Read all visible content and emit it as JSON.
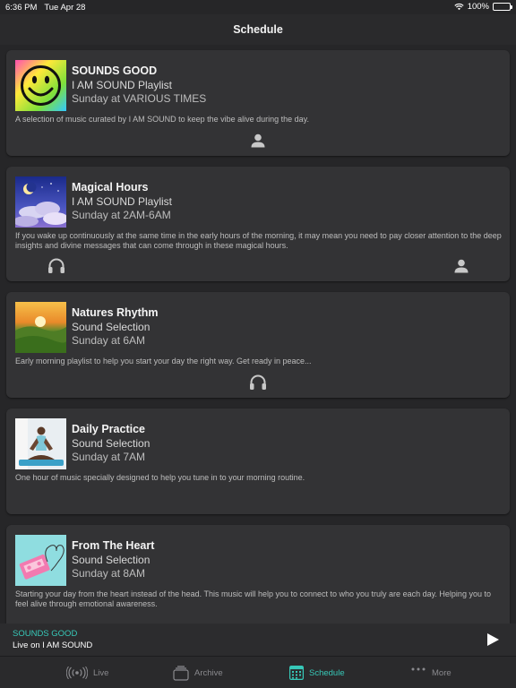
{
  "status_bar": {
    "time": "6:36 PM",
    "date": "Tue Apr 28",
    "battery": "100%"
  },
  "header": {
    "title": "Schedule"
  },
  "schedule": [
    {
      "title": "SOUNDS GOOD",
      "subtitle": "I AM SOUND Playlist",
      "time": "Sunday at VARIOUS TIMES",
      "description": "A selection of music curated by I AM SOUND to keep the vibe alive during the day.",
      "icon": "smiley-image"
    },
    {
      "title": "Magical Hours",
      "subtitle": "I AM SOUND Playlist",
      "time": "Sunday at 2AM-6AM",
      "description": "If you wake up continuously at the same time in the early hours of the morning, it may mean you need to pay closer attention to the deep insights and divine messages that can come through in these magical hours.",
      "icon": "moon-clouds-image"
    },
    {
      "title": "Natures Rhythm",
      "subtitle": "Sound Selection",
      "time": "Sunday at 6AM",
      "description": "Early morning playlist to help you start your day the right way. Get ready in peace...",
      "icon": "sunrise-landscape-image"
    },
    {
      "title": "Daily Practice",
      "subtitle": "Sound Selection",
      "time": "Sunday at 7AM",
      "description": "One hour of music specially designed to help you tune in to your morning routine.",
      "icon": "meditation-image"
    },
    {
      "title": "From The Heart",
      "subtitle": "Sound Selection",
      "time": "Sunday at 8AM",
      "description": "Starting your day from the heart instead of the head. This music will help you to connect to who you truly are each day. Helping you to feel alive through emotional awareness.",
      "icon": "cassette-heart-image"
    }
  ],
  "now_playing": {
    "title": "SOUNDS GOOD",
    "subtitle": "Live on I AM SOUND"
  },
  "tabs": [
    {
      "label": "Live",
      "icon": "radio-waves-icon"
    },
    {
      "label": "Archive",
      "icon": "archive-stack-icon"
    },
    {
      "label": "Schedule",
      "icon": "calendar-grid-icon",
      "active": true
    },
    {
      "label": "More",
      "icon": "more-dots-icon"
    }
  ],
  "colors": {
    "accent": "#37c8b8",
    "background": "#262628",
    "card": "#333335"
  }
}
